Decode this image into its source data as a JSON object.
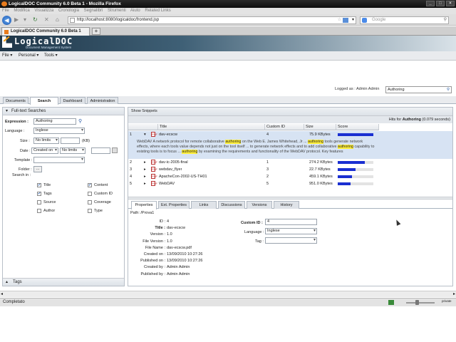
{
  "window": {
    "title": "LogicalDOC Community 6.0 Beta 1 - Mozilla Firefox"
  },
  "browser": {
    "menu": [
      "File",
      "Modifica",
      "Visualizza",
      "Cronologia",
      "Segnalibri",
      "Strumenti",
      "Aiuto",
      "Related Links"
    ],
    "url": "http://localhost:8080/logicaldoc/frontend.jsp",
    "search_placeholder": "Google",
    "tab_title": "LogicalDOC Community 6.0 Beta 1",
    "status": "Completato",
    "private_label": "private"
  },
  "app": {
    "title": "LogicalDOC",
    "subtitle": "Document Management System",
    "menu": [
      "File",
      "Personal",
      "Tools"
    ],
    "logged_as": "Logged as : Admin Admin",
    "quick_search_value": "Authoring",
    "tabs": [
      "Documents",
      "Search",
      "Dashboard",
      "Administration"
    ],
    "active_tab": "Search"
  },
  "search_form": {
    "header": "Full-text Searches",
    "expression_label": "Expression :",
    "expression_value": "Authoring",
    "language_label": "Language :",
    "language_value": "Inglese",
    "size_label": "Size :",
    "size_value": "No limits",
    "size_unit": "(KB)",
    "date_label": "Date :",
    "date_field": "Created on",
    "date_value": "No limits",
    "template_label": "Template :",
    "folder_label": "Folder :",
    "folder_button": "...",
    "search_in_label": "Search in :",
    "fields": [
      {
        "label": "Title",
        "checked": true
      },
      {
        "label": "Content",
        "checked": true
      },
      {
        "label": "Tags",
        "checked": true
      },
      {
        "label": "Custom ID",
        "checked": false
      },
      {
        "label": "Source",
        "checked": false
      },
      {
        "label": "Coverage",
        "checked": false
      },
      {
        "label": "Author",
        "checked": false
      },
      {
        "label": "Type",
        "checked": false
      }
    ],
    "tags_header": "Tags"
  },
  "results": {
    "show_snippets": "Show Snippets",
    "hits_prefix": "Hits for",
    "hits_query": "Authoring",
    "hits_suffix": "(0.079 seconds)",
    "columns": [
      "Title",
      "Custom ID",
      "Size",
      "Score"
    ],
    "rows": [
      {
        "n": "1",
        "title": "dav-ecscw",
        "custom_id": "4",
        "size": "75.9 KBytes",
        "score": 1.0
      },
      {
        "n": "2",
        "title": "dav-ic-2005-final",
        "custom_id": "1",
        "size": "274.2 KBytes",
        "score": 0.75
      },
      {
        "n": "3",
        "title": "webdav_flyer",
        "custom_id": "3",
        "size": "22.7 KBytes",
        "score": 0.5
      },
      {
        "n": "4",
        "title": "ApacheCon-2002-US-TH01",
        "custom_id": "2",
        "size": "459.1 KBytes",
        "score": 0.4
      },
      {
        "n": "5",
        "title": "WebDAV",
        "custom_id": "5",
        "size": "951.0 KBytes",
        "score": 0.35
      }
    ],
    "snippet_parts": [
      {
        "t": "WebDAV A network protocol for remote collaborative ",
        "hl": false
      },
      {
        "t": "authoring",
        "hl": true
      },
      {
        "t": " on the Web E. James Whitehead, Jr ... ",
        "hl": false
      },
      {
        "t": "authoring",
        "hl": true
      },
      {
        "t": " tools generate network effects, where each tools value depends not just on the tool itself ... to generate network effects and to add collaborative ",
        "hl": false
      },
      {
        "t": "authoring",
        "hl": true
      },
      {
        "t": " capability to existing tools is to focus ... ",
        "hl": false
      },
      {
        "t": "authoring",
        "hl": true
      },
      {
        "t": " by examining the requirements and functionality of the WebDAV protocol. Key features",
        "hl": false
      }
    ]
  },
  "details": {
    "tabs": [
      "Properties",
      "Ext. Properties",
      "Links",
      "Discussions",
      "Versions",
      "History"
    ],
    "path": "Path: /Prova1",
    "props": [
      {
        "label": "ID :",
        "value": "4"
      },
      {
        "label": "Title :",
        "value": "dav-ecscw"
      },
      {
        "label": "Version :",
        "value": "1.0"
      },
      {
        "label": "File Version :",
        "value": "1.0"
      },
      {
        "label": "File Name :",
        "value": "dav-ecscw.pdf"
      },
      {
        "label": "Created on :",
        "value": "13/09/2010 10:27:26"
      },
      {
        "label": "Published on :",
        "value": "13/09/2010 10:27:26"
      },
      {
        "label": "Created by :",
        "value": "Admin Admin"
      },
      {
        "label": "Published by :",
        "value": "Admin Admin"
      }
    ],
    "custom_id_label": "Custom ID :",
    "custom_id_value": "4",
    "language_label": "Language :",
    "language_value": "Inglese",
    "tag_label": "Tag :"
  }
}
